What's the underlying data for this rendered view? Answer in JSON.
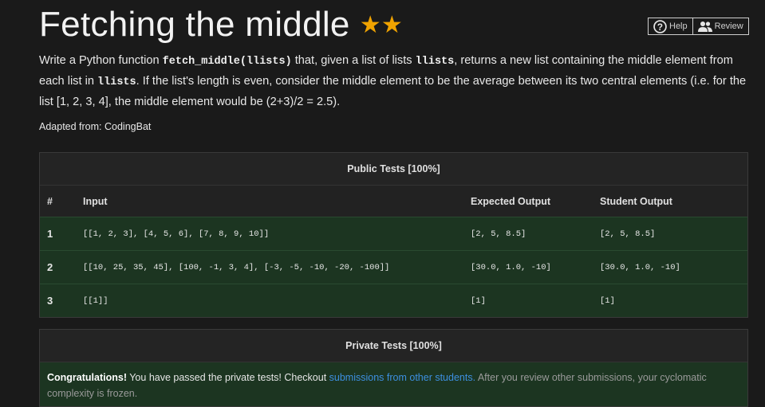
{
  "title": "Fetching the middle",
  "stars": "★★",
  "buttons": {
    "help": "Help",
    "review": "Review"
  },
  "description": {
    "p1": "Write a Python function ",
    "fn": "fetch_middle(llists)",
    "p2": " that, given a list of lists ",
    "arg": "llists",
    "p3": ", returns a new list containing the middle element from each list in ",
    "arg2": "llists",
    "p4": ". If the list's length is even, consider the middle element to be the average between its two central elements (i.e. for the list [1, 2, 3, 4], the middle element would be (2+3)/2 = 2.5)."
  },
  "adapted": "Adapted from: CodingBat",
  "public_tests": {
    "header": "Public Tests [100%]",
    "columns": [
      "#",
      "Input",
      "Expected Output",
      "Student Output"
    ],
    "rows": [
      {
        "num": "1",
        "input": "[[1, 2, 3], [4, 5, 6], [7, 8, 9, 10]]",
        "expected": "[2, 5, 8.5]",
        "student": "[2, 5, 8.5]"
      },
      {
        "num": "2",
        "input": "[[10, 25, 35, 45], [100, -1, 3, 4], [-3, -5, -10, -20, -100]]",
        "expected": "[30.0, 1.0, -10]",
        "student": "[30.0, 1.0, -10]"
      },
      {
        "num": "3",
        "input": "[[1]]",
        "expected": "[1]",
        "student": "[1]"
      }
    ]
  },
  "private_tests": {
    "header": "Private Tests [100%]",
    "congrats": "Congratulations!",
    "passed": " You have passed the private tests! Checkout ",
    "link": "submissions from other students.",
    "rest": " After you review other submissions, your cyclomatic complexity is frozen."
  },
  "colors": {
    "accent_star": "#f0a300",
    "pass_row": "#1c3521",
    "link": "#3d8fe0"
  }
}
